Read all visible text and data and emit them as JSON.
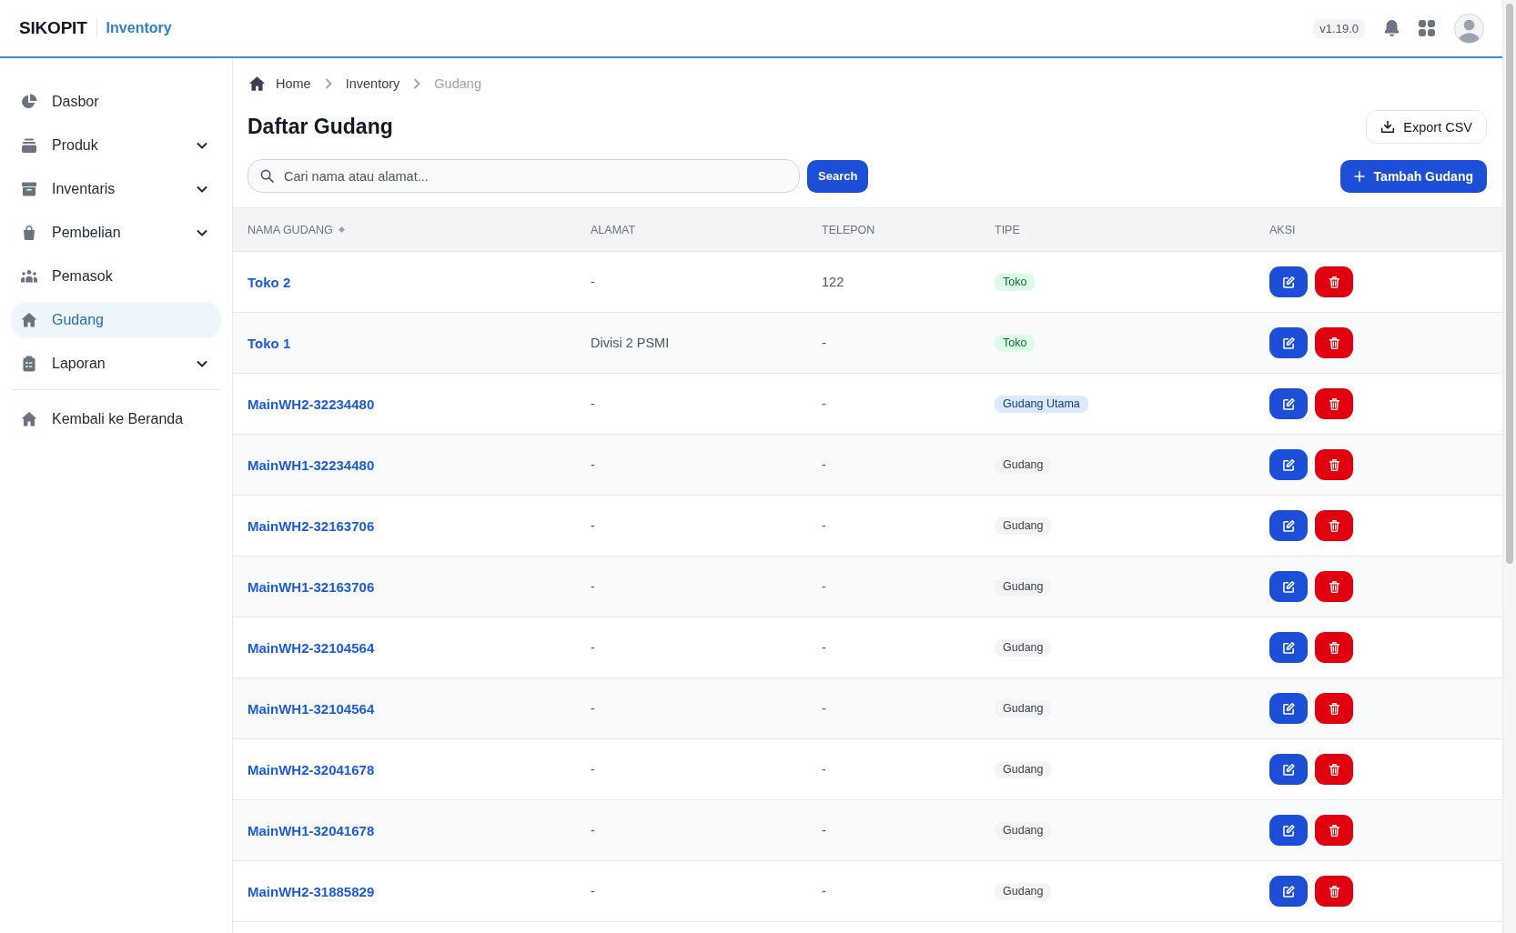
{
  "topbar": {
    "brand": "SIKOPIT",
    "module": "Inventory",
    "version": "v1.19.0"
  },
  "sidebar": {
    "items": [
      {
        "label": "Dasbor",
        "kind": "link",
        "selected": false
      },
      {
        "label": "Produk",
        "kind": "group",
        "selected": false
      },
      {
        "label": "Inventaris",
        "kind": "group",
        "selected": false
      },
      {
        "label": "Pembelian",
        "kind": "group",
        "selected": false
      },
      {
        "label": "Pemasok",
        "kind": "link",
        "selected": false
      },
      {
        "label": "Gudang",
        "kind": "link",
        "selected": true
      },
      {
        "label": "Laporan",
        "kind": "group",
        "selected": false
      }
    ],
    "back_link": {
      "label": "Kembali ke Beranda"
    }
  },
  "breadcrumb": [
    {
      "label": "Home",
      "current": false
    },
    {
      "label": "Inventory",
      "current": false
    },
    {
      "label": "Gudang",
      "current": true
    }
  ],
  "page": {
    "title": "Daftar Gudang",
    "export_button": "Export CSV",
    "search": {
      "placeholder": "Cari nama atau alamat...",
      "button": "Search"
    },
    "add_button": "Tambah Gudang"
  },
  "table": {
    "columns": [
      {
        "label": "NAMA GUDANG",
        "sortable": true
      },
      {
        "label": "ALAMAT",
        "sortable": false
      },
      {
        "label": "TELEPON",
        "sortable": false
      },
      {
        "label": "TIPE",
        "sortable": false
      },
      {
        "label": "AKSI",
        "sortable": false
      }
    ],
    "rows": [
      {
        "name": "Toko 2",
        "address": "-",
        "phone": "122",
        "type": {
          "label": "Toko",
          "color": "#dcfce7"
        }
      },
      {
        "name": "Toko 1",
        "address": "Divisi 2 PSMI",
        "phone": "-",
        "type": {
          "label": "Toko",
          "color": "#dcfce7"
        }
      },
      {
        "name": "MainWH2-32234480",
        "address": "-",
        "phone": "-",
        "type": {
          "label": "Gudang Utama",
          "color": "#dbeafe"
        }
      },
      {
        "name": "MainWH1-32234480",
        "address": "-",
        "phone": "-",
        "type": {
          "label": "Gudang",
          "color": "#f3f4f6"
        }
      },
      {
        "name": "MainWH2-32163706",
        "address": "-",
        "phone": "-",
        "type": {
          "label": "Gudang",
          "color": "#f3f4f6"
        }
      },
      {
        "name": "MainWH1-32163706",
        "address": "-",
        "phone": "-",
        "type": {
          "label": "Gudang",
          "color": "#f3f4f6"
        }
      },
      {
        "name": "MainWH2-32104564",
        "address": "-",
        "phone": "-",
        "type": {
          "label": "Gudang",
          "color": "#f3f4f6"
        }
      },
      {
        "name": "MainWH1-32104564",
        "address": "-",
        "phone": "-",
        "type": {
          "label": "Gudang",
          "color": "#f3f4f6"
        }
      },
      {
        "name": "MainWH2-32041678",
        "address": "-",
        "phone": "-",
        "type": {
          "label": "Gudang",
          "color": "#f3f4f6"
        }
      },
      {
        "name": "MainWH1-32041678",
        "address": "-",
        "phone": "-",
        "type": {
          "label": "Gudang",
          "color": "#f3f4f6"
        }
      },
      {
        "name": "MainWH2-31885829",
        "address": "-",
        "phone": "-",
        "type": {
          "label": "Gudang",
          "color": "#f3f4f6"
        }
      }
    ]
  }
}
